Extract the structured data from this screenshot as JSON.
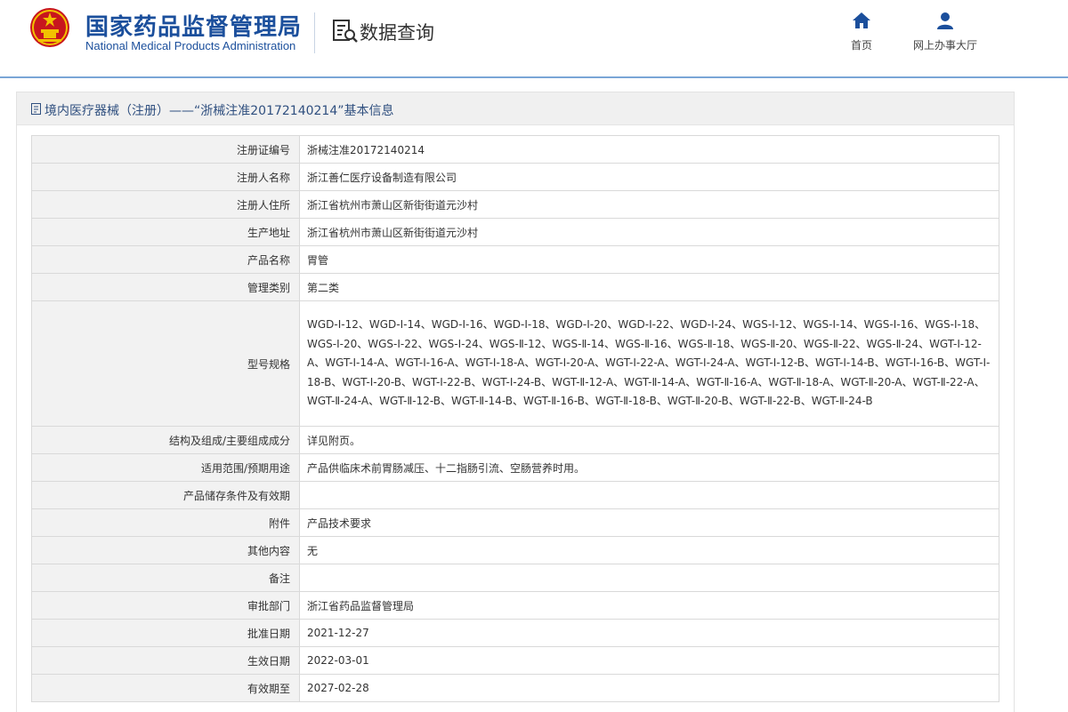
{
  "header": {
    "logo_cn": "国家药品监督管理局",
    "logo_en": "National Medical Products Administration",
    "query_title": "数据查询",
    "nav": [
      {
        "label": "首页",
        "icon": "home-icon"
      },
      {
        "label": "网上办事大厅",
        "icon": "user-icon"
      }
    ]
  },
  "panel": {
    "title": "境内医疗器械（注册）——“浙械注准20172140214”基本信息"
  },
  "rows": [
    {
      "label": "注册证编号",
      "value": "浙械注准20172140214"
    },
    {
      "label": "注册人名称",
      "value": "浙江善仁医疗设备制造有限公司"
    },
    {
      "label": "注册人住所",
      "value": "浙江省杭州市萧山区新街街道元沙村"
    },
    {
      "label": "生产地址",
      "value": "浙江省杭州市萧山区新街街道元沙村"
    },
    {
      "label": "产品名称",
      "value": "胃管"
    },
    {
      "label": "管理类别",
      "value": "第二类"
    },
    {
      "label": "型号规格",
      "value": "WGD-Ⅰ-12、WGD-Ⅰ-14、WGD-Ⅰ-16、WGD-Ⅰ-18、WGD-Ⅰ-20、WGD-Ⅰ-22、WGD-Ⅰ-24、WGS-Ⅰ-12、WGS-Ⅰ-14、WGS-Ⅰ-16、WGS-Ⅰ-18、WGS-Ⅰ-20、WGS-Ⅰ-22、WGS-Ⅰ-24、WGS-Ⅱ-12、WGS-Ⅱ-14、WGS-Ⅱ-16、WGS-Ⅱ-18、WGS-Ⅱ-20、WGS-Ⅱ-22、WGS-Ⅱ-24、WGT-Ⅰ-12-A、WGT-Ⅰ-14-A、WGT-Ⅰ-16-A、WGT-Ⅰ-18-A、WGT-Ⅰ-20-A、WGT-Ⅰ-22-A、WGT-Ⅰ-24-A、WGT-Ⅰ-12-B、WGT-Ⅰ-14-B、WGT-Ⅰ-16-B、WGT-Ⅰ-18-B、WGT-Ⅰ-20-B、WGT-Ⅰ-22-B、WGT-Ⅰ-24-B、WGT-Ⅱ-12-A、WGT-Ⅱ-14-A、WGT-Ⅱ-16-A、WGT-Ⅱ-18-A、WGT-Ⅱ-20-A、WGT-Ⅱ-22-A、WGT-Ⅱ-24-A、WGT-Ⅱ-12-B、WGT-Ⅱ-14-B、WGT-Ⅱ-16-B、WGT-Ⅱ-18-B、WGT-Ⅱ-20-B、WGT-Ⅱ-22-B、WGT-Ⅱ-24-B"
    },
    {
      "label": "结构及组成/主要组成成分",
      "value": "详见附页。"
    },
    {
      "label": "适用范围/预期用途",
      "value": "产品供临床术前胃肠减压、十二指肠引流、空肠营养时用。"
    },
    {
      "label": "产品储存条件及有效期",
      "value": ""
    },
    {
      "label": "附件",
      "value": "产品技术要求"
    },
    {
      "label": "其他内容",
      "value": "无"
    },
    {
      "label": "备注",
      "value": ""
    },
    {
      "label": "审批部门",
      "value": "浙江省药品监督管理局"
    },
    {
      "label": "批准日期",
      "value": "2021-12-27"
    },
    {
      "label": "生效日期",
      "value": "2022-03-01"
    },
    {
      "label": "有效期至",
      "value": "2027-02-28"
    }
  ],
  "colors": {
    "brand_blue": "#1b4f9c",
    "emblem_red": "#c8161d",
    "emblem_gold": "#f2c200",
    "label_bg": "#f2f2f2",
    "border": "#d9d9d9"
  }
}
